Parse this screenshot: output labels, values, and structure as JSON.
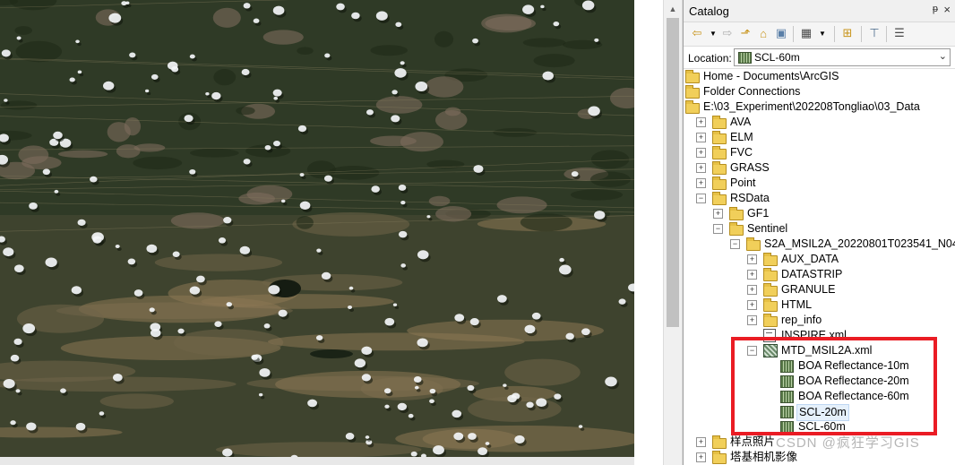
{
  "catalog": {
    "title": "Catalog",
    "pin_glyph": "ᵽ",
    "close_glyph": "×",
    "toolbar_icons": [
      "back-arrow-icon",
      "dropdown-icon",
      "forward-arrow-icon",
      "up-folder-icon",
      "home-icon",
      "connect-folder-icon",
      "view-options-icon",
      "view-dropdown-icon",
      "new-item-icon",
      "tree-view-icon",
      "details-icon"
    ],
    "location_label": "Location:",
    "location_value": "SCL-60m"
  },
  "tree": [
    {
      "label": "Home - Documents\\ArcGIS",
      "icon": "home-folder-icon",
      "indent": 0,
      "expander": ""
    },
    {
      "label": "Folder Connections",
      "icon": "folder-connection-icon",
      "indent": 0,
      "expander": ""
    },
    {
      "label": "E:\\03_Experiment\\202208Tongliao\\03_Data",
      "icon": "folder-icon",
      "indent": 0,
      "expander": ""
    },
    {
      "label": "AVA",
      "icon": "folder-icon",
      "indent": 1,
      "expander": "+"
    },
    {
      "label": "ELM",
      "icon": "folder-icon",
      "indent": 1,
      "expander": "+"
    },
    {
      "label": "FVC",
      "icon": "folder-icon",
      "indent": 1,
      "expander": "+"
    },
    {
      "label": "GRASS",
      "icon": "folder-icon",
      "indent": 1,
      "expander": "+"
    },
    {
      "label": "Point",
      "icon": "folder-icon",
      "indent": 1,
      "expander": "+"
    },
    {
      "label": "RSData",
      "icon": "folder-icon",
      "indent": 1,
      "expander": "−"
    },
    {
      "label": "GF1",
      "icon": "folder-icon",
      "indent": 2,
      "expander": "+"
    },
    {
      "label": "Sentinel",
      "icon": "folder-icon",
      "indent": 2,
      "expander": "−"
    },
    {
      "label": "S2A_MSIL2A_20220801T023541_N04",
      "icon": "folder-icon",
      "indent": 3,
      "expander": "−"
    },
    {
      "label": "AUX_DATA",
      "icon": "folder-icon",
      "indent": 4,
      "expander": "+"
    },
    {
      "label": "DATASTRIP",
      "icon": "folder-icon",
      "indent": 4,
      "expander": "+"
    },
    {
      "label": "GRANULE",
      "icon": "folder-icon",
      "indent": 4,
      "expander": "+"
    },
    {
      "label": "HTML",
      "icon": "folder-icon",
      "indent": 4,
      "expander": "+"
    },
    {
      "label": "rep_info",
      "icon": "folder-icon",
      "indent": 4,
      "expander": "+"
    },
    {
      "label": "INSPIRE.xml",
      "icon": "xml-file-icon",
      "indent": 4,
      "expander": ""
    },
    {
      "label": "MTD_MSIL2A.xml",
      "icon": "raster-dataset-icon",
      "indent": 4,
      "expander": "−"
    },
    {
      "label": "BOA Reflectance-10m",
      "icon": "raster-band-icon",
      "indent": 5,
      "expander": ""
    },
    {
      "label": "BOA Reflectance-20m",
      "icon": "raster-band-icon",
      "indent": 5,
      "expander": ""
    },
    {
      "label": "BOA Reflectance-60m",
      "icon": "raster-band-icon",
      "indent": 5,
      "expander": ""
    },
    {
      "label": "SCL-20m",
      "icon": "raster-band-icon",
      "indent": 5,
      "expander": "",
      "highlight": true
    },
    {
      "label": "SCL-60m",
      "icon": "raster-band-icon",
      "indent": 5,
      "expander": ""
    },
    {
      "label": "样点照片",
      "icon": "folder-icon",
      "indent": 1,
      "expander": "+"
    },
    {
      "label": "塔基相机影像",
      "icon": "folder-icon",
      "indent": 1,
      "expander": "+"
    }
  ],
  "watermark": "CSDN @疯狂学习GIS",
  "colors": {
    "highlight_box": "#ea1c24",
    "selection": "#e5f0fb"
  }
}
